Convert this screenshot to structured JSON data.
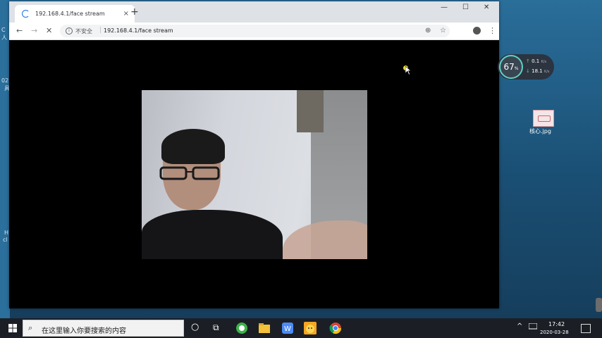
{
  "browser": {
    "tab_title": "192.168.4.1/face stream",
    "tab_close": "×",
    "new_tab": "+",
    "window_controls": {
      "minimize": "—",
      "maximize": "☐",
      "close": "✕"
    },
    "nav": {
      "back": "←",
      "forward": "→",
      "stop": "✕"
    },
    "security_label": "不安全",
    "separator": "|",
    "url": "192.168.4.1/face stream",
    "zoom_icon": "⊕",
    "bookmark_icon": "☆",
    "menu_icon": "⋮"
  },
  "desktop": {
    "left_fragments": [
      "C",
      "人",
      "02",
      "具",
      "H",
      "cl"
    ],
    "file_name": "核心.jpg"
  },
  "netmon": {
    "percent": "67",
    "percent_unit": "%",
    "up_value": "0.1",
    "up_unit": "K/s",
    "down_value": "18.1",
    "down_unit": "K/s",
    "up_arrow": "↑",
    "down_arrow": "↓"
  },
  "taskbar": {
    "search_placeholder": "在这里输入你要搜索的内容",
    "search_icon": "⌕",
    "cortana_icon": "○",
    "taskview_icon": "⧉",
    "tray_caret": "^",
    "time": "17:42",
    "date": "2020-03-28"
  },
  "colors": {
    "accent": "#1a73e8",
    "taskbar": "#1b1f25",
    "desktop": "#1d5f8a"
  }
}
